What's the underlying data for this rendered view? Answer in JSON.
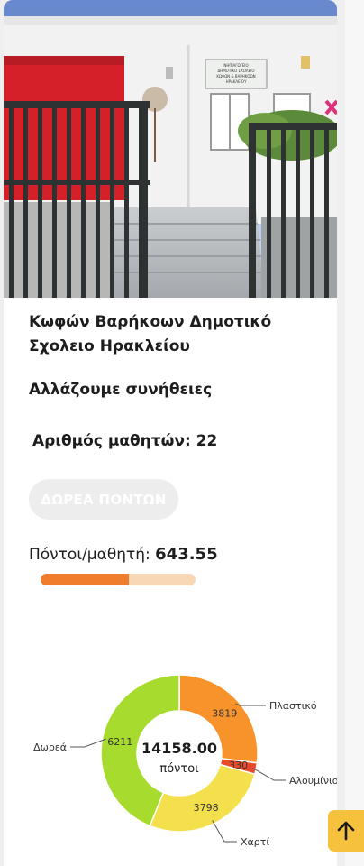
{
  "school": {
    "name": "Κωφών Βαρήκοων Δημοτικό Σχολειο Ηρακλείου",
    "motto": "Αλλάζουμε συνήθειες",
    "sign_text": "ΝΗΠΙΑΓΩΓΕΙΟ ΔΗΜΟΤΙΚΟ ΣΧΟΛΕΙΟ ΚΩΦΩΝ & ΒΑΡΗΚΟΩΝ ΗΡΑΚΛΕΙΟΥ"
  },
  "students": {
    "label": "Αριθμός μαθητών:",
    "count": "22"
  },
  "donate_button": {
    "label": "ΔΩΡΕΑ ΠΟΝΤΩΝ"
  },
  "points_per_student": {
    "label": "Πόντοι/μαθητή:",
    "value": "643.55",
    "progress_fraction": 0.57
  },
  "chart_data": {
    "type": "pie",
    "center_value": "14158.00",
    "center_label": "πόντοι",
    "slices": [
      {
        "name": "Πλαστικό",
        "value": 3819,
        "label": "3819",
        "color": "#f7932a"
      },
      {
        "name": "Αλουμίνιο",
        "value": 330,
        "label": "330",
        "color": "#e84b2b"
      },
      {
        "name": "Χαρτί",
        "value": 3798,
        "label": "3798",
        "color": "#f4e04d"
      },
      {
        "name": "Δωρεά",
        "value": 6211,
        "label": "6211",
        "color": "#a7dc2e"
      }
    ],
    "callouts": [
      "Πλαστικό",
      "Αλουμίνιο",
      "Χαρτί",
      "Δωρεά"
    ]
  },
  "scroll_top_icon": "arrow-up-icon",
  "colors": {
    "accent_orange": "#f07d2c",
    "progress_track": "#f8d7b5",
    "scroll_top_bg": "#f6c13c",
    "button_disabled_bg": "#ededed"
  }
}
